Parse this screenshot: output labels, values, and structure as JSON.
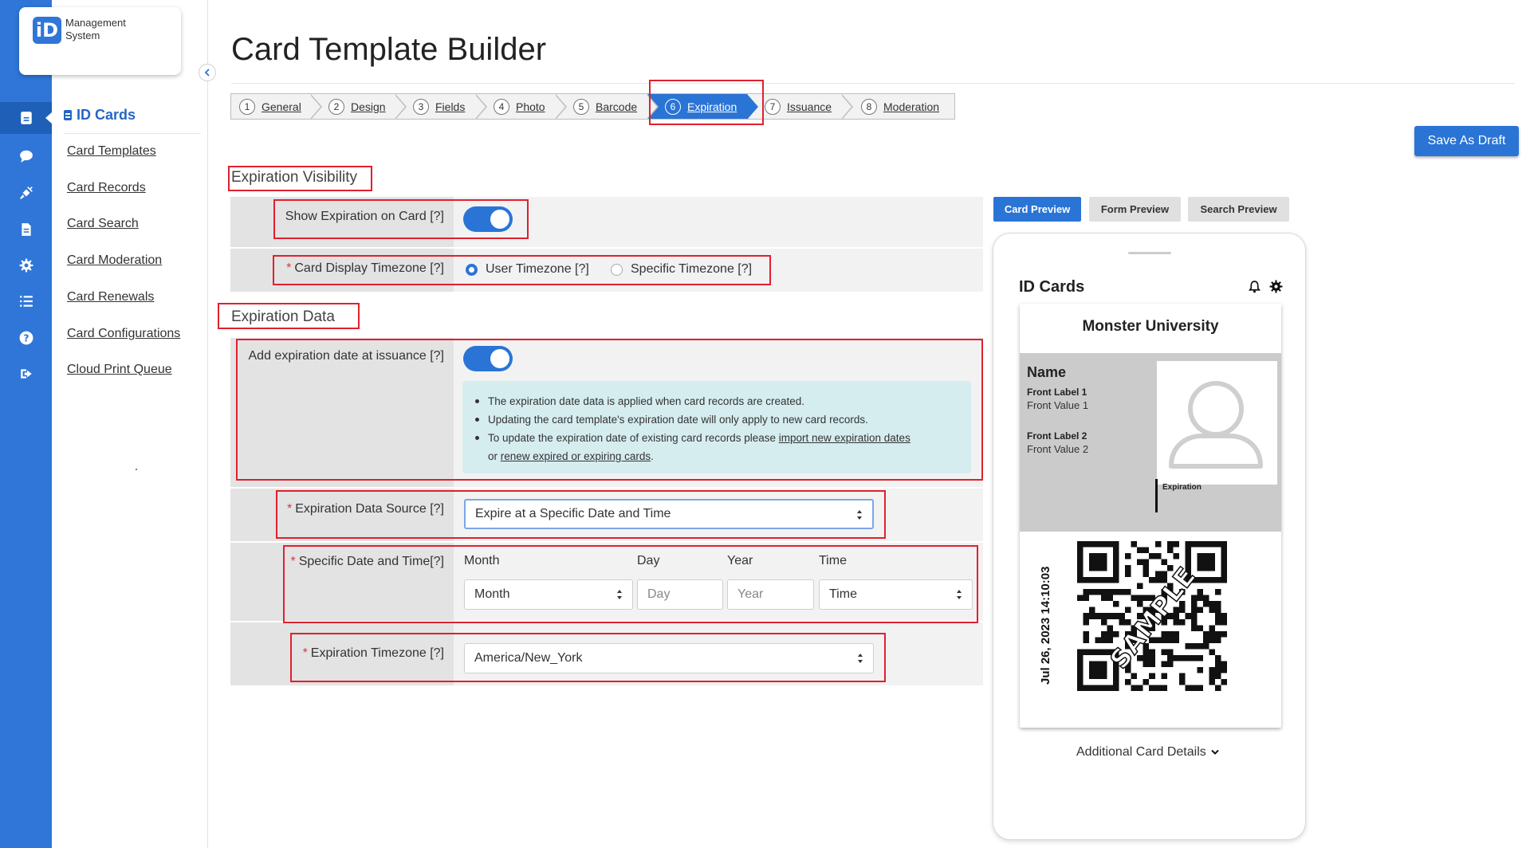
{
  "app": {
    "logo_mark": "iD",
    "logo_line1": "Management",
    "logo_line2": "System"
  },
  "rail": {
    "icons": [
      "id-card-icon",
      "chat-icon",
      "plug-icon",
      "document-icon",
      "gear-icon",
      "list-icon",
      "help-icon",
      "logout-icon"
    ],
    "active_index": 0,
    "accent": "#2f76d8"
  },
  "subnav": {
    "title": "ID Cards",
    "links": [
      "Card Templates",
      "Card Records",
      "Card Search",
      "Card Moderation",
      "Card Renewals",
      "Card Configurations",
      "Cloud Print Queue"
    ]
  },
  "page": {
    "title": "Card Template Builder",
    "save_label": "Save As Draft"
  },
  "steps": [
    {
      "num": "1",
      "label": "General"
    },
    {
      "num": "2",
      "label": "Design"
    },
    {
      "num": "3",
      "label": "Fields"
    },
    {
      "num": "4",
      "label": "Photo"
    },
    {
      "num": "5",
      "label": "Barcode"
    },
    {
      "num": "6",
      "label": "Expiration",
      "active": true
    },
    {
      "num": "7",
      "label": "Issuance"
    },
    {
      "num": "8",
      "label": "Moderation"
    }
  ],
  "visibility": {
    "heading": "Expiration Visibility",
    "show_label": "Show Expiration on Card [?]",
    "show_on": true,
    "tz_label": "Card Display Timezone [?]",
    "tz_options": [
      "User Timezone [?]",
      "Specific Timezone [?]"
    ],
    "tz_selected": "User Timezone [?]"
  },
  "data": {
    "heading": "Expiration Data",
    "add_label": "Add expiration date at issuance [?]",
    "add_on": true,
    "info": {
      "line1": "The expiration date data is applied when card records are created.",
      "line2": "Updating the card template's expiration date will only apply to new card records.",
      "line3_prefix": "To update the expiration date of existing card records please ",
      "line3_link": "import new expiration dates",
      "line4_prefix": "or ",
      "line4_link": "renew expired or expiring cards",
      "line4_suffix": "."
    },
    "source_label": "Expiration Data Source [?]",
    "source_value": "Expire at a Specific Date and Time",
    "specific_label": "Specific Date and Time[?]",
    "columns": [
      "Month",
      "Day",
      "Year",
      "Time"
    ],
    "month_value": "Month",
    "day_placeholder": "Day",
    "year_placeholder": "Year",
    "time_value": "Time",
    "tz_label": "Expiration Timezone [?]",
    "tz_value": "America/New_York"
  },
  "preview": {
    "tabs": [
      "Card Preview",
      "Form Preview",
      "Search Preview"
    ],
    "active_tab": "Card Preview",
    "phone_title": "ID Cards",
    "university": "Monster University",
    "name": "Name",
    "front_label_1": "Front Label 1",
    "front_value_1": "Front Value 1",
    "front_label_2": "Front Label 2",
    "front_value_2": "Front Value 2",
    "expiration_label": "Expiration",
    "stamp_text": "Jul 26, 2023   14:10:03",
    "watermark": "SAMPLE",
    "more_details": "Additional Card Details"
  }
}
